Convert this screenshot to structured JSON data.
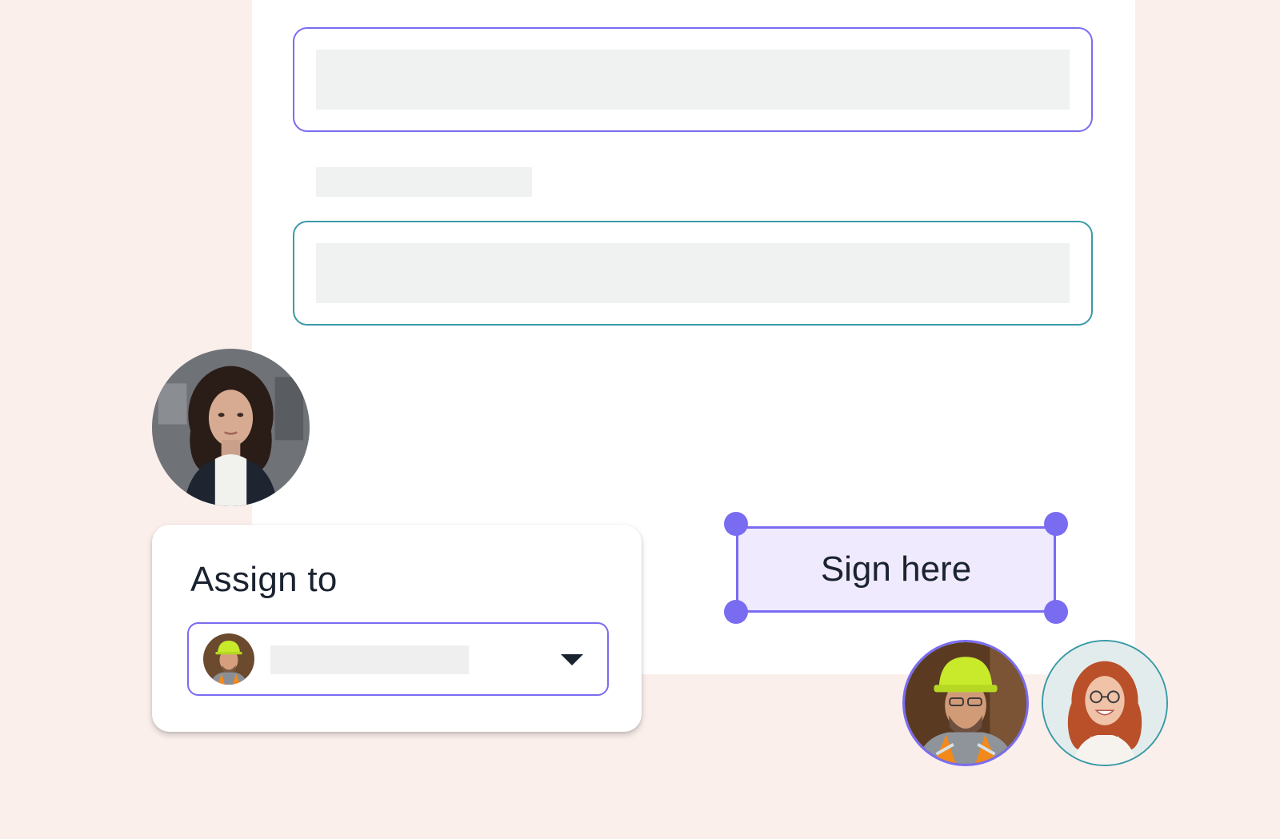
{
  "assign": {
    "title": "Assign to",
    "selected_assignee_avatar": "worker-avatar",
    "dropdown_icon": "caret-down-icon"
  },
  "signature_field": {
    "label": "Sign here"
  },
  "avatars": [
    {
      "name": "woman-dark-hair-avatar"
    },
    {
      "name": "construction-worker-avatar"
    },
    {
      "name": "woman-red-hair-avatar"
    }
  ],
  "colors": {
    "background": "#fbefec",
    "accent_purple": "#7a6cf0",
    "accent_teal": "#3a9aa6",
    "sign_fill": "#efeafd",
    "placeholder": "#f0f2f2"
  }
}
